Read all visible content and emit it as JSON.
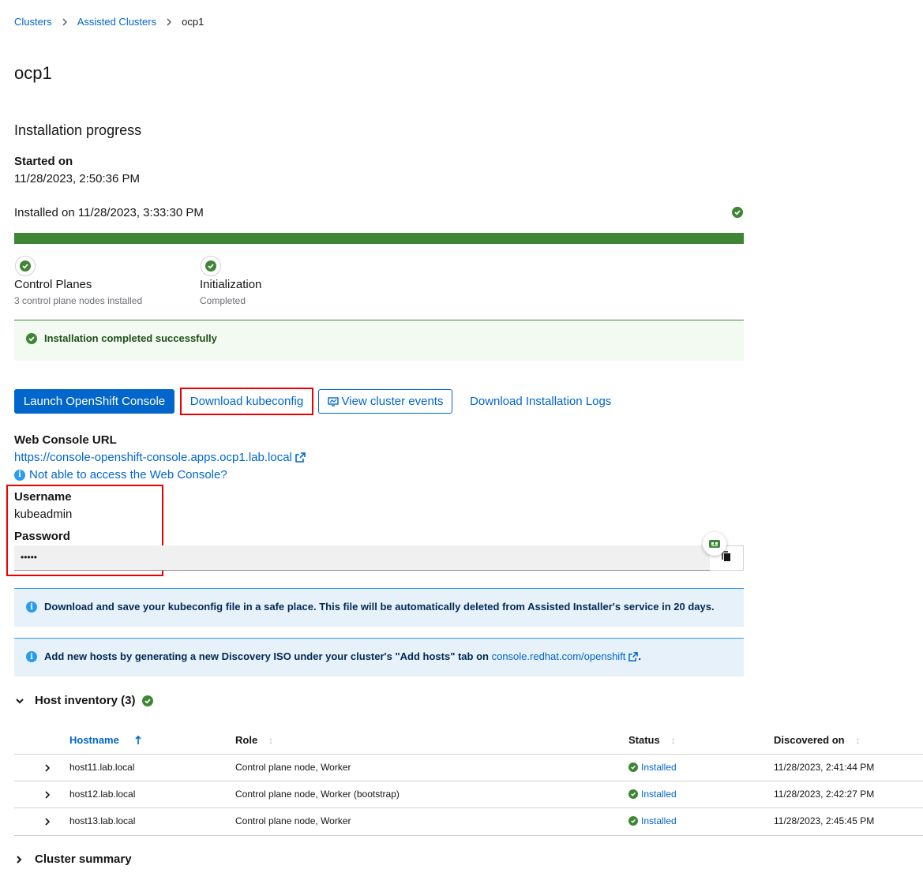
{
  "breadcrumb": [
    "Clusters",
    "Assisted Clusters",
    "ocp1"
  ],
  "page_title": "ocp1",
  "section_title": "Installation progress",
  "started": {
    "label": "Started on",
    "value": "11/28/2023, 2:50:36 PM"
  },
  "installed_text": "Installed on 11/28/2023, 3:33:30 PM",
  "progress_percent": 100,
  "steps": [
    {
      "title": "Control Planes",
      "subtitle": "3 control plane nodes installed"
    },
    {
      "title": "Initialization",
      "subtitle": "Completed"
    }
  ],
  "success_alert": "Installation completed successfully",
  "buttons": {
    "launch_console": "Launch OpenShift Console",
    "download_kubeconfig": "Download kubeconfig",
    "view_events": "View cluster events",
    "download_logs": "Download Installation Logs"
  },
  "web_console": {
    "label": "Web Console URL",
    "url": "https://console-openshift-console.apps.ocp1.lab.local",
    "help_link": "Not able to access the Web Console?"
  },
  "credentials": {
    "username_label": "Username",
    "username": "kubeadmin",
    "password_label": "Password",
    "password_masked": "•••••"
  },
  "info_alerts": {
    "kubeconfig": "Download and save your kubeconfig file in a safe place. This file will be automatically deleted from Assisted Installer's service in 20 days.",
    "add_hosts_prefix": "Add new hosts by generating a new Discovery ISO under your cluster's \"Add hosts\" tab on ",
    "add_hosts_link": "console.redhat.com/openshift",
    "add_hosts_suffix": "."
  },
  "host_inventory": {
    "title": "Host inventory (3)",
    "columns": [
      "Hostname",
      "Role",
      "Status",
      "Discovered on"
    ],
    "rows": [
      {
        "hostname": "host11.lab.local",
        "role": "Control plane node, Worker",
        "status": "Installed",
        "discovered": "11/28/2023, 2:41:44 PM"
      },
      {
        "hostname": "host12.lab.local",
        "role": "Control plane node, Worker (bootstrap)",
        "status": "Installed",
        "discovered": "11/28/2023, 2:42:27 PM"
      },
      {
        "hostname": "host13.lab.local",
        "role": "Control plane node, Worker",
        "status": "Installed",
        "discovered": "11/28/2023, 2:45:45 PM"
      }
    ]
  },
  "cluster_summary": "Cluster summary"
}
